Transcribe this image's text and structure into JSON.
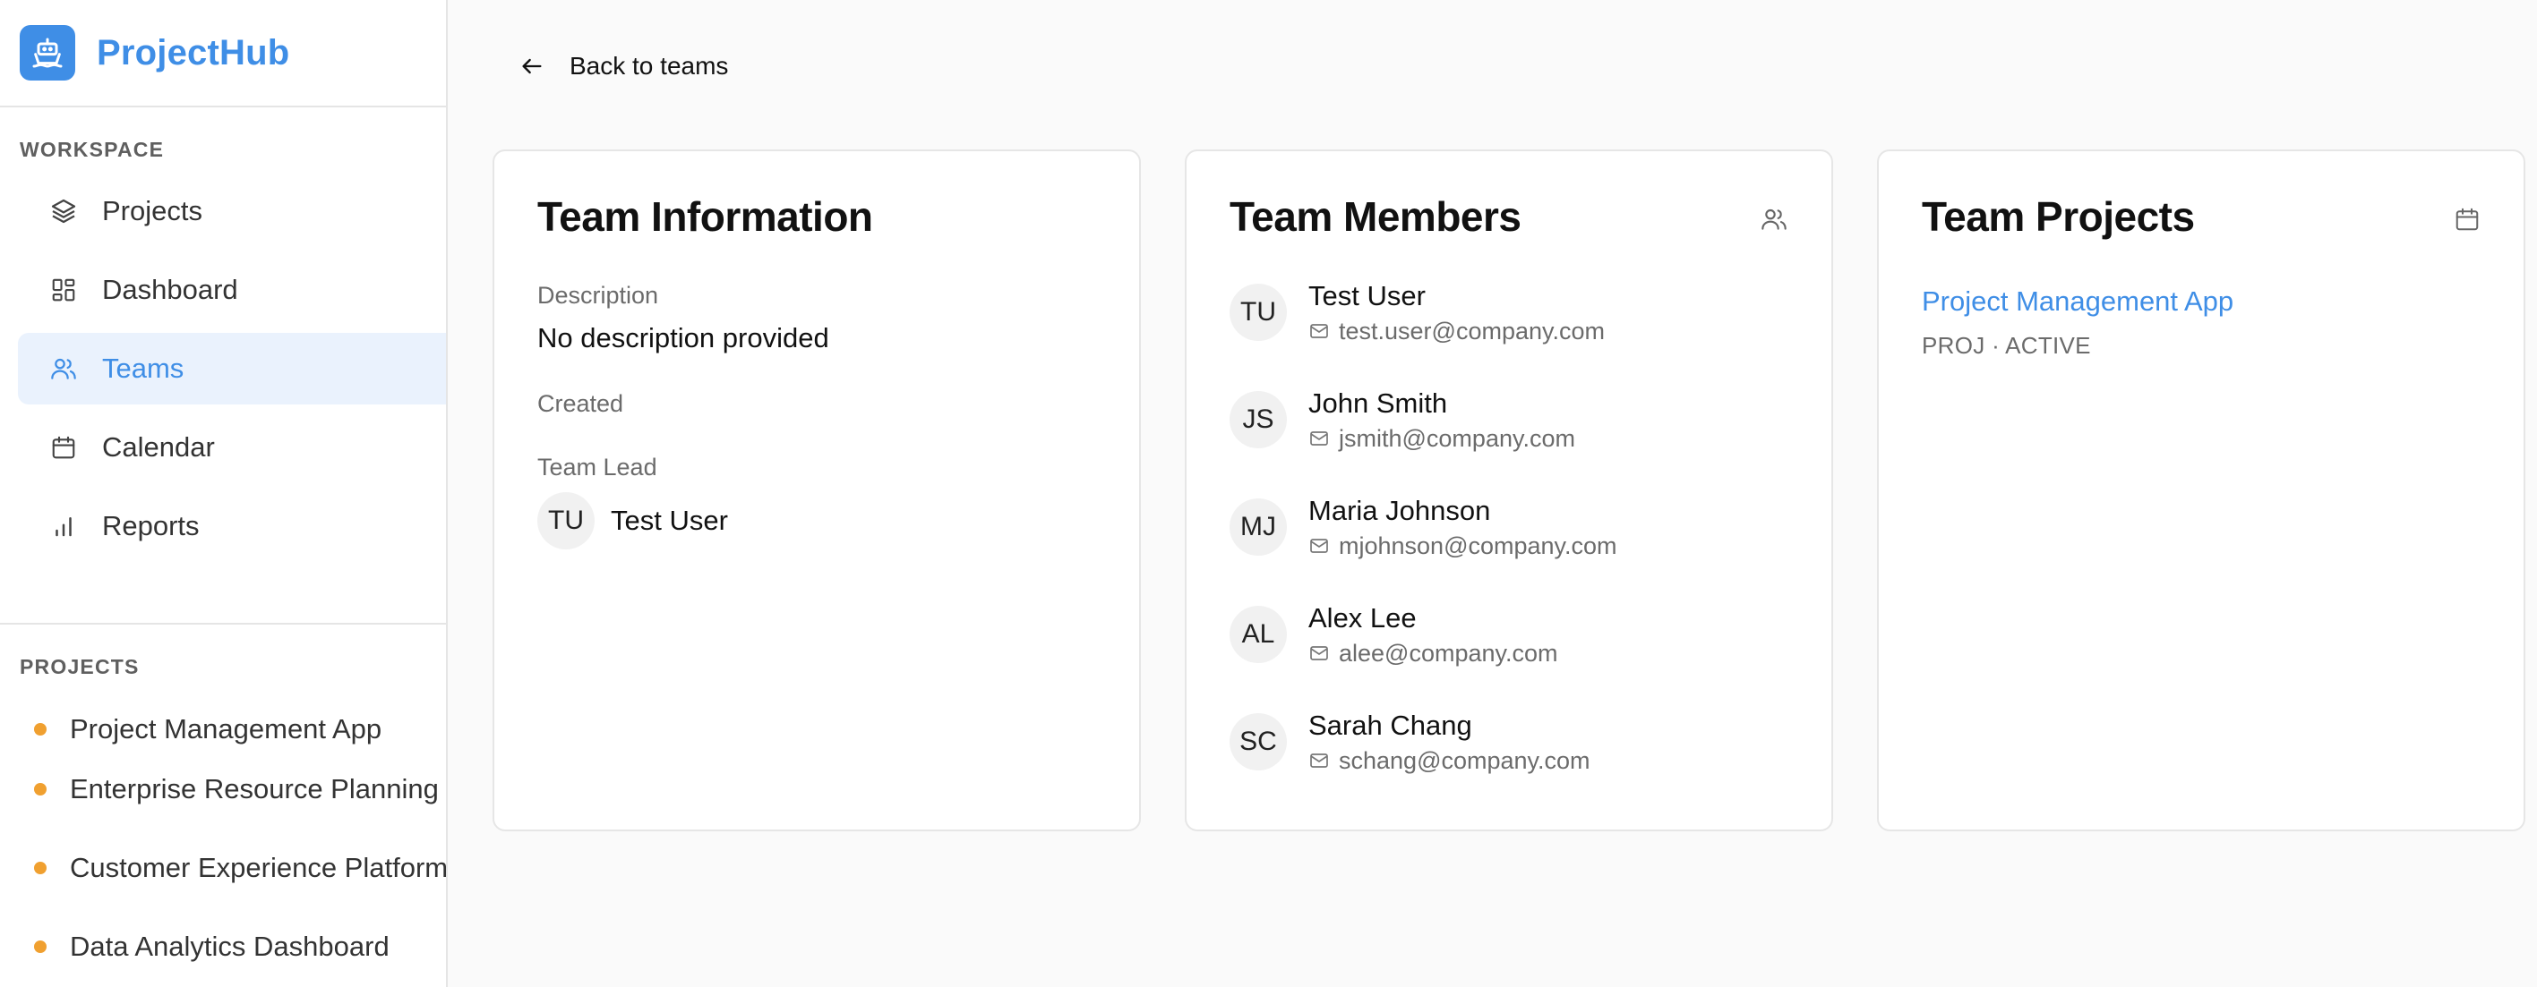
{
  "app": {
    "name": "ProjectHub",
    "brand_color": "#3f8ee6"
  },
  "sidebar": {
    "workspace_label": "WORKSPACE",
    "nav": [
      {
        "label": "Projects",
        "icon": "layers-icon",
        "active": false
      },
      {
        "label": "Dashboard",
        "icon": "dashboard-icon",
        "active": false
      },
      {
        "label": "Teams",
        "icon": "users-icon",
        "active": true
      },
      {
        "label": "Calendar",
        "icon": "calendar-icon",
        "active": false
      },
      {
        "label": "Reports",
        "icon": "bar-chart-icon",
        "active": false
      }
    ],
    "projects_label": "PROJECTS",
    "projects": [
      {
        "label": "Project Management App",
        "status_color": "#f0a030"
      },
      {
        "label": "Enterprise Resource Planning",
        "status_color": "#f0a030"
      },
      {
        "label": "Customer Experience Platform",
        "status_color": "#f0a030"
      },
      {
        "label": "Data Analytics Dashboard",
        "status_color": "#f0a030"
      }
    ]
  },
  "main": {
    "back_label": "Back to teams",
    "team_info": {
      "title": "Team Information",
      "description_label": "Description",
      "description_value": "No description provided",
      "created_label": "Created",
      "lead_label": "Team Lead",
      "lead_initials": "TU",
      "lead_name": "Test User"
    },
    "team_members": {
      "title": "Team Members",
      "members": [
        {
          "initials": "TU",
          "name": "Test User",
          "email": "test.user@company.com"
        },
        {
          "initials": "JS",
          "name": "John Smith",
          "email": "jsmith@company.com"
        },
        {
          "initials": "MJ",
          "name": "Maria Johnson",
          "email": "mjohnson@company.com"
        },
        {
          "initials": "AL",
          "name": "Alex Lee",
          "email": "alee@company.com"
        },
        {
          "initials": "SC",
          "name": "Sarah Chang",
          "email": "schang@company.com"
        }
      ]
    },
    "team_projects": {
      "title": "Team Projects",
      "projects": [
        {
          "name": "Project Management App",
          "meta": "PROJ · ACTIVE"
        }
      ]
    }
  }
}
